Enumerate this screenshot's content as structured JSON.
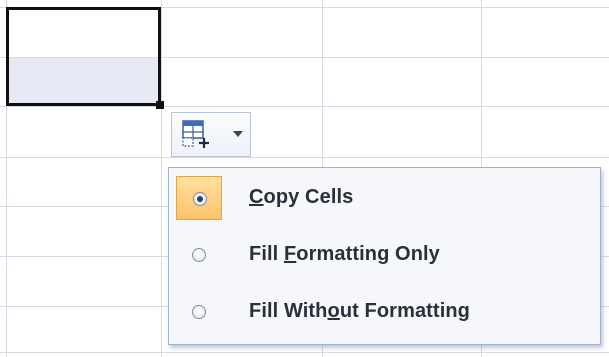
{
  "autofill_options": {
    "button_icon": "autofill-options-icon",
    "dropdown_icon": "chevron-down-icon",
    "menu": {
      "items": [
        {
          "pre": "",
          "key": "C",
          "post": "opy Cells",
          "label": "Copy Cells",
          "selected": true
        },
        {
          "pre": "Fill ",
          "key": "F",
          "post": "ormatting Only",
          "label": "Fill Formatting Only",
          "selected": false
        },
        {
          "pre": "Fill With",
          "key": "o",
          "post": "ut Formatting",
          "label": "Fill Without Formatting",
          "selected": false
        }
      ]
    }
  },
  "colors": {
    "gridline": "#d4dbe6",
    "selection_border": "#101010",
    "selected_highlight": "#fbc46a",
    "menu_background": "#f6f7fa"
  }
}
